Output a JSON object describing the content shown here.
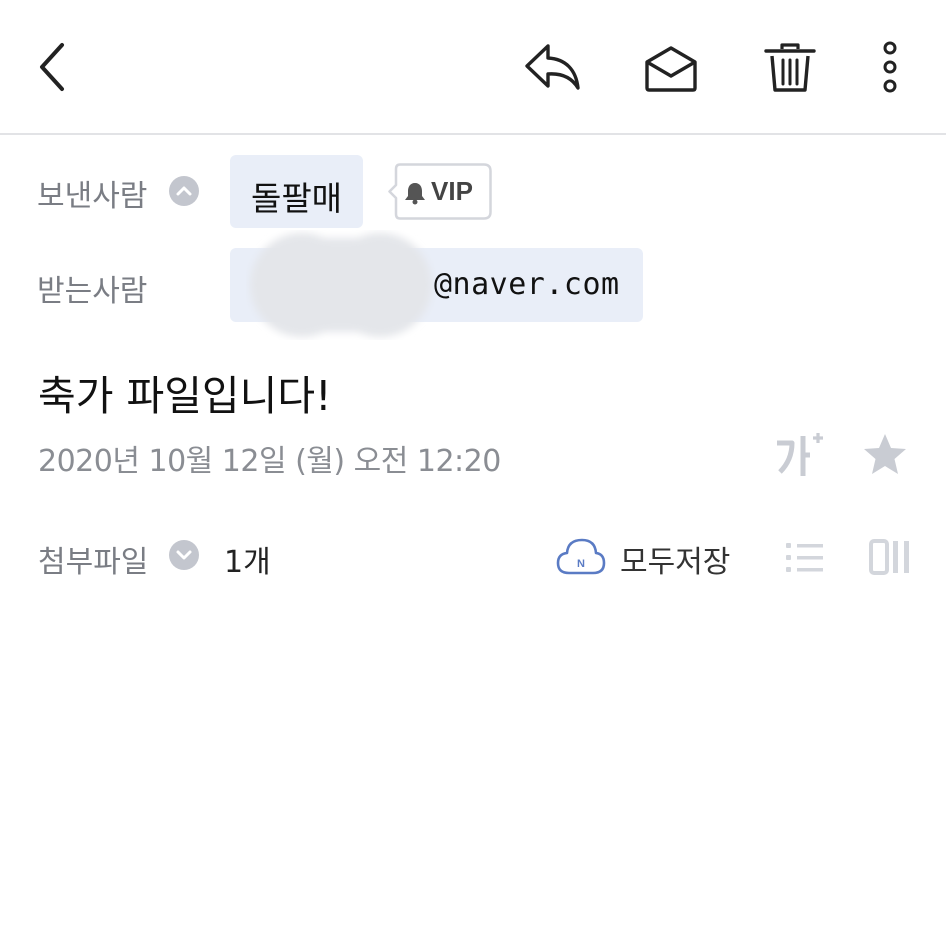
{
  "header": {
    "back_icon": "chevron-left-icon",
    "reply_icon": "reply-icon",
    "mark_unread_icon": "envelope-open-icon",
    "delete_icon": "trash-icon",
    "more_icon": "more-vertical-icon"
  },
  "sender": {
    "label": "보낸사람",
    "name": "돌팔매",
    "vip_label": "VIP"
  },
  "recipient": {
    "label": "받는사람",
    "email_suffix": "@naver.com"
  },
  "message": {
    "subject": "축가 파일입니다!",
    "date": "2020년 10월 12일 (월) 오전 12:20"
  },
  "attachments": {
    "label": "첨부파일",
    "count": "1개",
    "save_all_label": "모두저장",
    "cloud_icon_letter": "N"
  },
  "colors": {
    "accent_blue": "#5a7bc4",
    "chip_bg": "#e9eef8",
    "muted_text": "#7a7d84",
    "disabled_icon": "#c9ccd3"
  }
}
